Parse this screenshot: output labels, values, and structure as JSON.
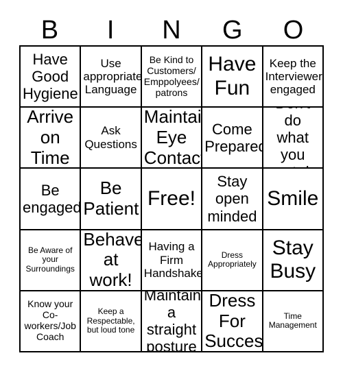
{
  "card": {
    "title": "BINGO",
    "header_letters": [
      "B",
      "I",
      "N",
      "G",
      "O"
    ],
    "grid_size": "5x5",
    "free_space_label": "Free!",
    "colors": {
      "background": "#ffffff",
      "text": "#000000",
      "grid_line": "#000000"
    },
    "rows": [
      [
        {
          "text": "Have\nGood\nHygiene",
          "size": "lg"
        },
        {
          "text": "Use\nappropriate\nLanguage",
          "size": "md"
        },
        {
          "text": "Be Kind to\nCustomers/\nEmppolyees/\npatrons",
          "size": "sm"
        },
        {
          "text": "Have\nFun",
          "size": "xxl"
        },
        {
          "text": "Keep the\nInterviewer\nengaged",
          "size": "md"
        }
      ],
      [
        {
          "text": "Arrive\non\nTime",
          "size": "xl"
        },
        {
          "text": "Ask\nQuestions",
          "size": "md"
        },
        {
          "text": "Maintain\nEye\nContact",
          "size": "xl"
        },
        {
          "text": "Come\nPrepared",
          "size": "lg"
        },
        {
          "text": "Don't do\nwhat you\ncant do",
          "size": "lg"
        }
      ],
      [
        {
          "text": "Be\nengaged",
          "size": "lg"
        },
        {
          "text": "Be\nPatient",
          "size": "xl"
        },
        {
          "text": "Free!",
          "size": "xxl"
        },
        {
          "text": "Stay\nopen\nminded",
          "size": "lg"
        },
        {
          "text": "Smile",
          "size": "xxl"
        }
      ],
      [
        {
          "text": "Be Aware of\nyour\nSurroundings",
          "size": "xs"
        },
        {
          "text": "Behave\nat\nwork!",
          "size": "xl"
        },
        {
          "text": "Having a\nFirm\nHandshake",
          "size": "md"
        },
        {
          "text": "Dress\nAppropriately",
          "size": "xs"
        },
        {
          "text": "Stay\nBusy",
          "size": "xxl"
        }
      ],
      [
        {
          "text": "Know your\nCo-\nworkers/Job\nCoach",
          "size": "sm"
        },
        {
          "text": "Keep a\nRespectable,\nbut loud tone",
          "size": "xs"
        },
        {
          "text": "Maintain\na straight\nposture",
          "size": "lg"
        },
        {
          "text": "Dress\nFor\nSuccess",
          "size": "xl"
        },
        {
          "text": "Time\nManagement",
          "size": "xs"
        }
      ]
    ]
  }
}
